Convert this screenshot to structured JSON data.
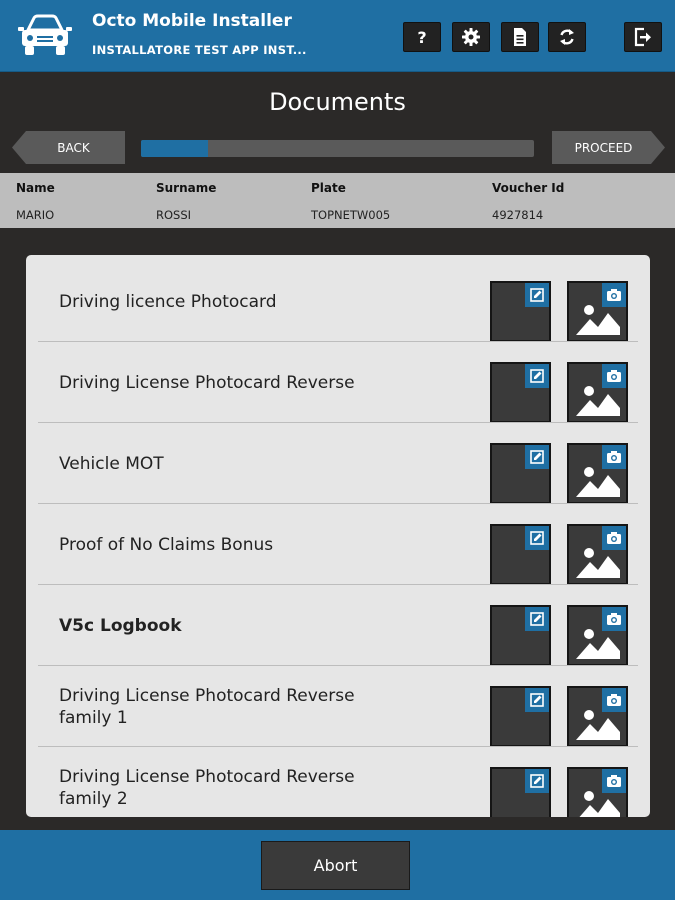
{
  "app": {
    "title": "Octo Mobile Installer",
    "subtitle": "INSTALLATORE TEST APP INST...",
    "toolbar": [
      {
        "name": "help-button",
        "icon": "question-icon"
      },
      {
        "name": "settings-button",
        "icon": "gear-icon"
      },
      {
        "name": "document-button",
        "icon": "document-icon"
      },
      {
        "name": "sync-button",
        "icon": "sync-icon"
      },
      {
        "name": "logout-button",
        "icon": "logout-icon"
      }
    ]
  },
  "header": {
    "title": "Documents",
    "back_label": "BACK",
    "proceed_label": "PROCEED",
    "progress_fraction": 0.17
  },
  "info": {
    "name_label": "Name",
    "name_value": "MARIO",
    "surname_label": "Surname",
    "surname_value": "ROSSI",
    "plate_label": "Plate",
    "plate_value": "TOPNETW005",
    "voucher_label": "Voucher Id",
    "voucher_value": "4927814"
  },
  "documents": [
    {
      "label": "Driving licence Photocard",
      "bold": false
    },
    {
      "label": "Driving License Photocard Reverse",
      "bold": false
    },
    {
      "label": "Vehicle MOT",
      "bold": false
    },
    {
      "label": "Proof of No Claims Bonus",
      "bold": false
    },
    {
      "label": "V5c Logbook",
      "bold": true
    },
    {
      "label": "Driving License Photocard Reverse family 1",
      "bold": false
    },
    {
      "label": "Driving License Photocard Reverse family 2",
      "bold": false
    }
  ],
  "footer": {
    "abort_label": "Abort"
  },
  "colors": {
    "primary": "#1f6fa3",
    "background": "#2b2928",
    "panel": "#e6e6e6"
  }
}
